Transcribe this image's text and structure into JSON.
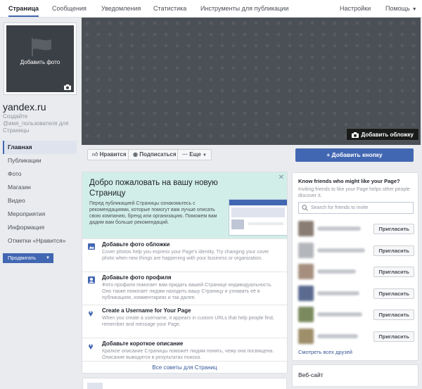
{
  "topnav": {
    "tabs": [
      "Страница",
      "Сообщения",
      "Уведомления",
      "Статистика",
      "Инструменты для публикации"
    ],
    "settings": "Настройки",
    "help": "Помощь"
  },
  "profile": {
    "add_photo": "Добавить фото",
    "name": "yandex.ru",
    "username_hint": "Создайте @имя_пользователя для Страницы"
  },
  "sidebar": {
    "items": [
      "Главная",
      "Публикации",
      "Фото",
      "Магазин",
      "Видео",
      "Мероприятия",
      "Информация",
      "Отметки «Нравится»"
    ],
    "promote": "Продвигать"
  },
  "cover": {
    "add_cover": "Добавить обложку"
  },
  "actions": {
    "like": "Нравится",
    "follow": "Подписаться",
    "more": "Еще",
    "add_button": "Добавить кнопку"
  },
  "welcome": {
    "title": "Добро пожаловать на вашу новую Страницу",
    "text": "Перед публикацией Страницы ознакомьтесь с рекомендациями, которые помогут вам лучше описать свою компанию, бренд или организацию. Поможем вам дадим вам больше рекомендаций."
  },
  "steps": [
    {
      "title": "Добавьте фото обложки",
      "desc": "Cover photos help you express your Page's identity. Try changing your cover photo when new things are happening with your business or organization."
    },
    {
      "title": "Добавьте фото профиля",
      "desc": "Фото профиля помогает вам придать вашей Странице индивидуальность. Оно также помогает людям находить вашу Страницу и узнавать её в публикациях, комментариях и так далее."
    },
    {
      "title": "Create a Username for Your Page",
      "desc": "When you create a username, it appears in custom URLs that help people find, remember and message your Page."
    },
    {
      "title": "Добавьте короткое описание",
      "desc": "Краткое описание Страницы поможет людям понять, чему она посвящена. Описание выводится в результатах поиска."
    }
  ],
  "all_tips": "Все советы для Страниц",
  "invite": {
    "title": "Know friends who might like your Page?",
    "subtitle": "Inviting friends to like your Page helps other people discover it.",
    "search_placeholder": "Search for friends to invite",
    "invite_label": "Пригласить",
    "see_all": "Смотреть всех друзей",
    "avatar_colors": [
      "#8a7d73",
      "#b3b6bb",
      "#a68f7e",
      "#5b6a8f",
      "#7a8a5e",
      "#9e8f6a"
    ]
  },
  "website": "Веб-сайт",
  "colors": {
    "accent": "#4267b2",
    "link": "#365899",
    "welcome_bg": "#d2eee8",
    "cover_bg": "#4b4f56"
  }
}
